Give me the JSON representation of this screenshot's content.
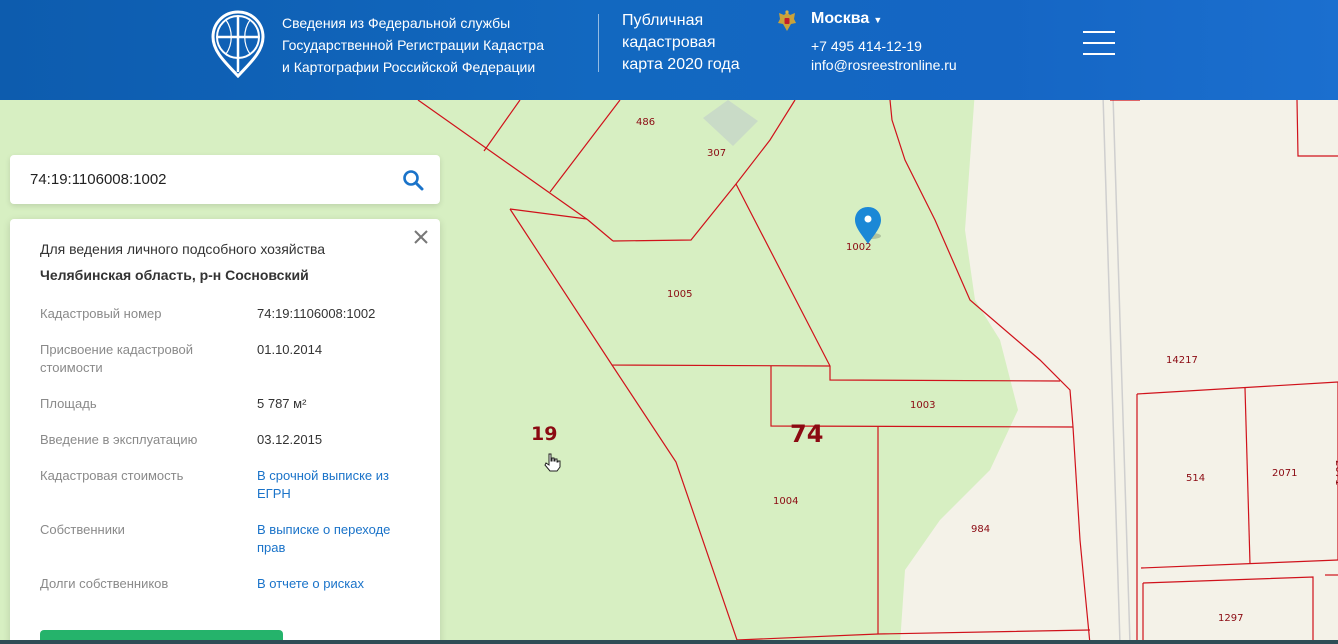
{
  "header": {
    "org_name": [
      "Сведения из Федеральной службы",
      "Государственной Регистрации Кадастра",
      "и Картографии Российской Федерации"
    ],
    "map_title": [
      "Публичная",
      "кадастровая",
      "карта 2020 года"
    ],
    "city": "Москва",
    "phone": "+7 495 414-12-19",
    "email": "info@rosreestronline.ru"
  },
  "search": {
    "value": "74:19:1106008:1002"
  },
  "panel": {
    "purpose": "Для ведения личного подсобного хозяйства",
    "region": "Челябинская область, р-н Сосновский",
    "properties": [
      {
        "key": "Кадастровый номер",
        "value": "74:19:1106008:1002",
        "link": false
      },
      {
        "key": "Присвоение кадастровой стоимости",
        "value": "01.10.2014",
        "link": false
      },
      {
        "key": "Площадь",
        "value": "5 787 м²",
        "link": false
      },
      {
        "key": "Введение в эксплуатацию",
        "value": "03.12.2015",
        "link": false
      },
      {
        "key": "Кадастровая стоимость",
        "value": "В срочной выписке из ЕГРН",
        "link": true
      },
      {
        "key": "Собственники",
        "value": "В выписке о переходе прав",
        "link": true
      },
      {
        "key": "Долги собственников",
        "value": "В отчете о рисках",
        "link": true
      }
    ]
  },
  "map": {
    "plot_labels": [
      "486",
      "307",
      "1002",
      "1005",
      "1003",
      "1004",
      "984",
      "14217",
      "514",
      "2071",
      "1297",
      "2071"
    ],
    "quarter_label": "19",
    "region_label": "74",
    "colors": {
      "park": "#d7efc2",
      "urban": "#f4f2e8",
      "boundary": "#d0121b",
      "header": "#1268c0",
      "link": "#1a73c9"
    }
  }
}
